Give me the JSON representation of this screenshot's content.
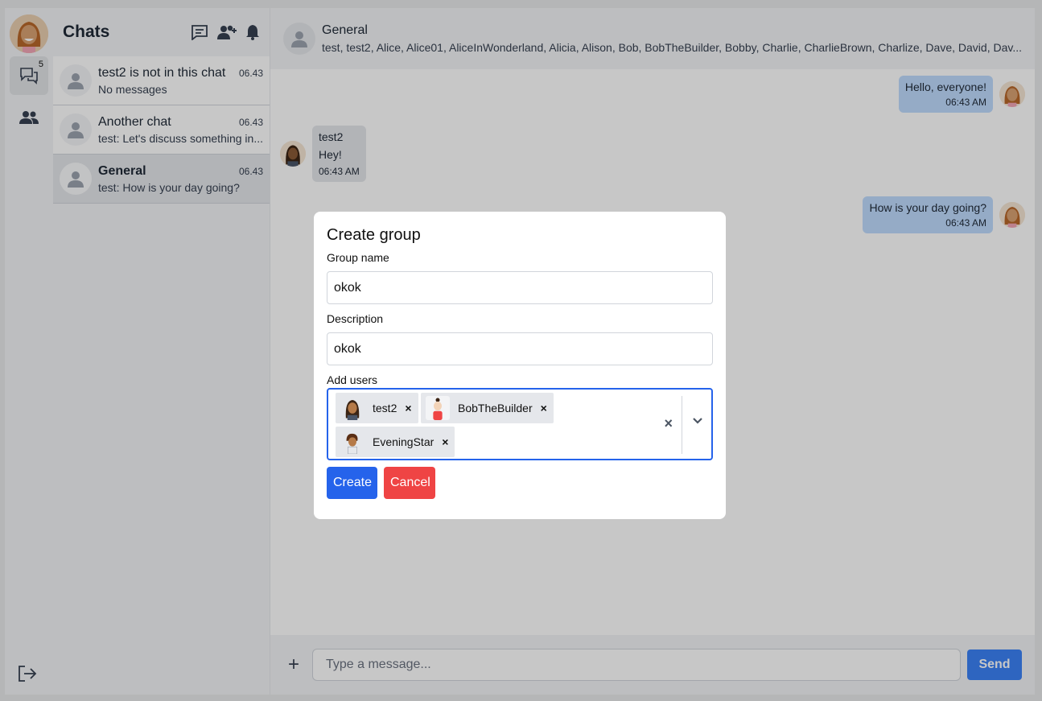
{
  "rail": {
    "unread_badge": "5",
    "items": [
      "chats-icon",
      "users-icon"
    ],
    "bottom": "logout-icon"
  },
  "sidebar": {
    "title": "Chats",
    "header_icons": [
      "new-chat-icon",
      "add-user-icon",
      "bell-icon"
    ],
    "chats": [
      {
        "name": "test2 is not in this chat",
        "time": "06.43",
        "last": "No messages",
        "selected": false
      },
      {
        "name": "Another chat",
        "time": "06.43",
        "last": "test: Let's discuss something in...",
        "selected": false
      },
      {
        "name": "General",
        "time": "06.43",
        "last": "test: How is your day going?",
        "selected": true
      }
    ]
  },
  "main": {
    "title": "General",
    "members": "test, test2, Alice, Alice01, AliceInWonderland, Alicia, Alison, Bob, BobTheBuilder, Bobby, Charlie, CharlieBrown, Charlize, Dave, David, Dav...",
    "messages": [
      {
        "direction": "out",
        "text": "Hello, everyone!",
        "time": "06:43 AM"
      },
      {
        "direction": "in",
        "sender": "test2",
        "text": "Hey!",
        "time": "06:43 AM"
      },
      {
        "direction": "out",
        "text": "How is your day going?",
        "time": "06:43 AM"
      }
    ],
    "composer": {
      "placeholder": "Type a message...",
      "send_label": "Send",
      "attach_icon": "plus-icon"
    }
  },
  "modal": {
    "title": "Create group",
    "group_name_label": "Group name",
    "group_name_value": "okok",
    "description_label": "Description",
    "description_value": "okok",
    "add_users_label": "Add users",
    "selected_users": [
      "test2",
      "BobTheBuilder",
      "EveningStar"
    ],
    "create_label": "Create",
    "cancel_label": "Cancel"
  },
  "colors": {
    "accent": "#2563eb",
    "danger": "#ef4444",
    "outgoing_bubble": "#bfdbfe",
    "incoming_bubble": "#e5e7eb"
  }
}
